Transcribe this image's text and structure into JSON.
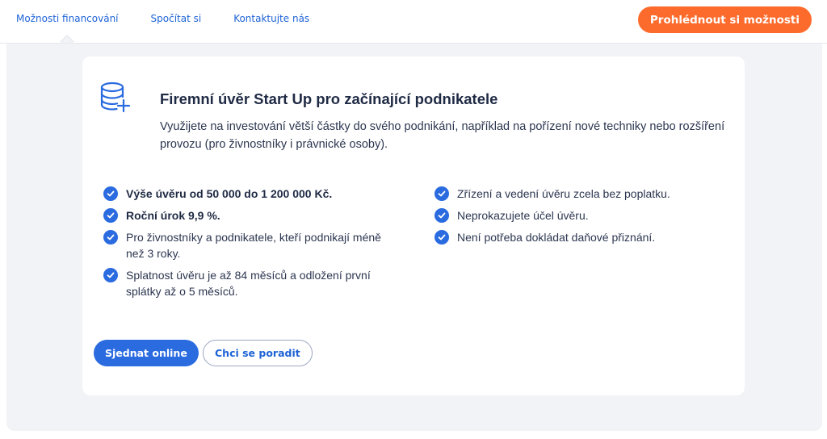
{
  "nav": {
    "items": [
      {
        "label": "Možnosti financování",
        "active": true
      },
      {
        "label": "Spočítat si",
        "active": false
      },
      {
        "label": "Kontaktujte nás",
        "active": false
      }
    ],
    "cta_label": "Prohlédnout si možnosti"
  },
  "product": {
    "icon": "database-plus-icon",
    "title": "Firemní úvěr Start Up pro začínající podnikatele",
    "description": "Využijete na investování větší částky do svého podnikání, například na pořízení nové techniky nebo rozšíření provozu (pro živnostníky i právnické osoby).",
    "features_left": [
      {
        "text": "Výše úvěru od 50 000 do 1 200 000 Kč.",
        "bold": true
      },
      {
        "text": "Roční úrok 9,9 %.",
        "bold": true
      },
      {
        "text": "Pro živnostníky a podnikatele, kteří podnikají méně než 3 roky.",
        "bold": false
      },
      {
        "text": "Splatnost úvěru je až 84 měsíců a odložení první splátky až o 5 měsíců.",
        "bold": false
      }
    ],
    "features_right": [
      {
        "text": "Zřízení a vedení úvěru zcela bez poplatku.",
        "bold": false
      },
      {
        "text": "Neprokazujete účel úvěru.",
        "bold": false
      },
      {
        "text": "Není potřeba dokládat daňové přiznání.",
        "bold": false
      }
    ],
    "primary_button": "Sjednat online",
    "secondary_button": "Chci se poradit"
  },
  "colors": {
    "accent_blue": "#2a6be0",
    "cta_orange": "#fd6b2c",
    "panel_bg": "#f2f3f6"
  }
}
